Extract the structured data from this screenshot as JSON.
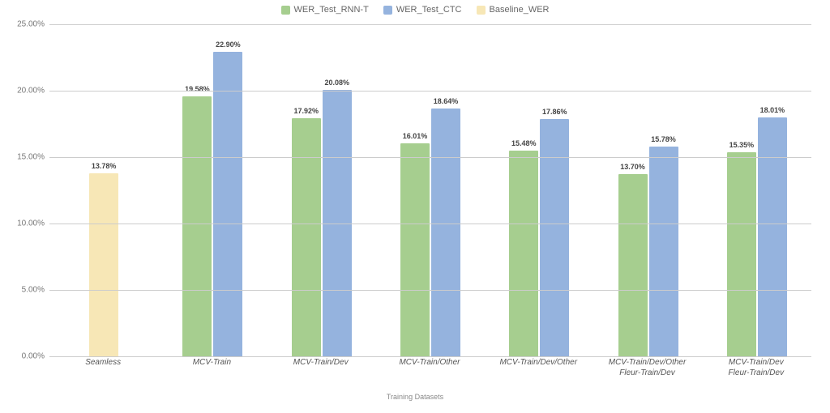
{
  "chart_data": {
    "type": "bar",
    "title": "",
    "xlabel": "Training Datasets",
    "ylabel": "",
    "ylim": [
      0,
      25
    ],
    "yticks": [
      0,
      5,
      10,
      15,
      20,
      25
    ],
    "ytick_labels": [
      "0.00%",
      "5.00%",
      "10.00%",
      "15.00%",
      "20.00%",
      "25.00%"
    ],
    "categories": [
      "Seamless",
      "MCV-Train",
      "MCV-Train/Dev",
      "MCV-Train/Other",
      "MCV-Train/Dev/Other",
      "MCV-Train/Dev/Other\nFleur-Train/Dev",
      "MCV-Train/Dev\nFleur-Train/Dev"
    ],
    "series": [
      {
        "name": "WER_Test_RNN-T",
        "color": "#a6ce8f",
        "values": [
          null,
          19.58,
          17.92,
          16.01,
          15.48,
          13.7,
          15.35
        ]
      },
      {
        "name": "WER_Test_CTC",
        "color": "#95b3de",
        "values": [
          null,
          22.9,
          20.08,
          18.64,
          17.86,
          15.78,
          18.01
        ]
      },
      {
        "name": "Baseline_WER",
        "color": "#f7e7b6",
        "values": [
          13.78,
          null,
          null,
          null,
          null,
          null,
          null
        ]
      }
    ],
    "value_suffix": "%"
  },
  "legend": {
    "rnnt": "WER_Test_RNN-T",
    "ctc": "WER_Test_CTC",
    "base": "Baseline_WER"
  }
}
